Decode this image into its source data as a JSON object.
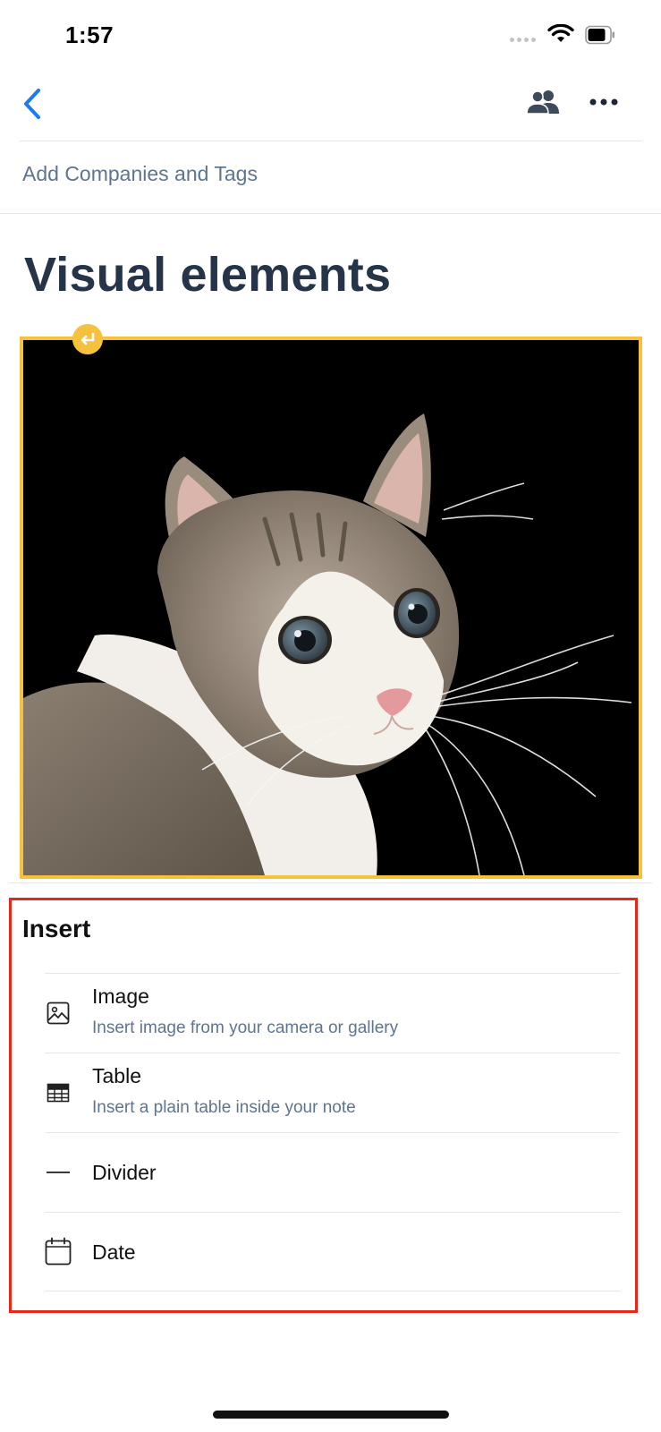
{
  "status_bar": {
    "time": "1:57"
  },
  "header": {
    "companies_tags_link": "Add Companies and Tags"
  },
  "note": {
    "title": "Visual elements"
  },
  "insert_menu": {
    "heading": "Insert",
    "items": [
      {
        "icon": "image-icon",
        "label": "Image",
        "description": "Insert image from your camera or gallery"
      },
      {
        "icon": "table-icon",
        "label": "Table",
        "description": "Insert a plain table inside your note"
      },
      {
        "icon": "divider-icon",
        "label": "Divider"
      },
      {
        "icon": "calendar-icon",
        "label": "Date"
      }
    ]
  },
  "colors": {
    "accent_blue": "#1a7bf2",
    "selection_yellow": "#f6c23e",
    "highlight_red": "#e8271c",
    "title_navy": "#253448",
    "muted_text": "#5f7490"
  }
}
